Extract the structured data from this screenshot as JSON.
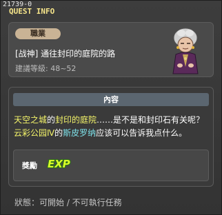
{
  "window": {
    "quest_id": "21739-0",
    "title": "QUEST INFO"
  },
  "summary": {
    "job_badge": "職業",
    "quest_name": "[战神] 通往封印的庭院的路",
    "level_label": "建議等級: 48~52",
    "npc_icon": "elderly-woman-npc-portrait"
  },
  "content": {
    "header": "內容",
    "desc": {
      "p1": "天空之城",
      "p2": "的",
      "p3": "封印的庭院",
      "p4": "……是不是和封印石有关呢？",
      "p5": "云彩公园Ⅳ",
      "p6": "的",
      "p7": "斯皮罗纳",
      "p8": "应该可以告诉我点什么。"
    },
    "reward": {
      "label": "獎勵",
      "exp_icon": "EXP"
    }
  },
  "status_text": "狀態：可開始 / 不可執行任務",
  "colors": {
    "highlight_yellow": "#f5f56a",
    "highlight_cyan": "#7ee0e8",
    "title_yellow": "#f6e58a"
  }
}
